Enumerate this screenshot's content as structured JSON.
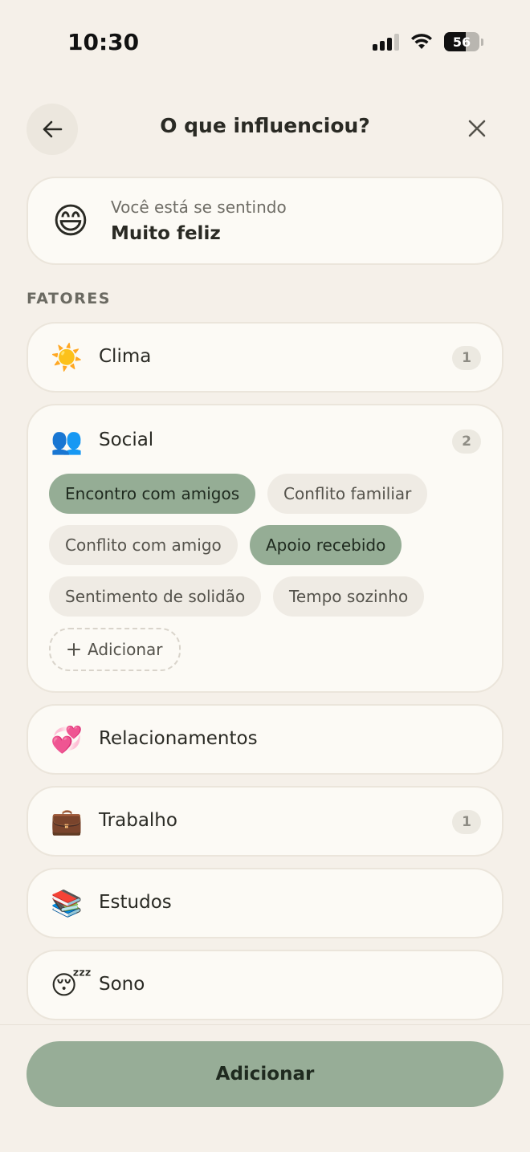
{
  "status_bar": {
    "time": "10:30",
    "battery": "56",
    "icons": [
      "signal-icon",
      "wifi-icon",
      "battery-icon"
    ]
  },
  "header": {
    "title": "O que influenciou?",
    "back_icon": "arrow-left-icon",
    "close_icon": "close-icon"
  },
  "feeling": {
    "emoji": "😄",
    "label": "Você está se sentindo",
    "value": "Muito feliz"
  },
  "section_label": "FATORES",
  "factors": [
    {
      "emoji": "☀️",
      "label": "Clima",
      "count": "1"
    },
    {
      "emoji": "👥",
      "label": "Social",
      "count": "2",
      "expanded": true,
      "tags": [
        {
          "label": "Encontro com amigos",
          "selected": true
        },
        {
          "label": "Conflito familiar",
          "selected": false
        },
        {
          "label": "Conflito com amigo",
          "selected": false
        },
        {
          "label": "Apoio recebido",
          "selected": true
        },
        {
          "label": "Sentimento de solidão",
          "selected": false
        },
        {
          "label": "Tempo sozinho",
          "selected": false
        }
      ],
      "add_tag_label": "Adicionar"
    },
    {
      "emoji": "💞",
      "label": "Relacionamentos"
    },
    {
      "emoji": "💼",
      "label": "Trabalho",
      "count": "1"
    },
    {
      "emoji": "📚",
      "label": "Estudos"
    },
    {
      "emoji": "😴",
      "label": "Sono"
    }
  ],
  "footer": {
    "button_label": "Adicionar"
  },
  "colors": {
    "background": "#f5f0e9",
    "card": "#fcfaf5",
    "accent": "#95ad95",
    "chip": "#efebe4"
  }
}
